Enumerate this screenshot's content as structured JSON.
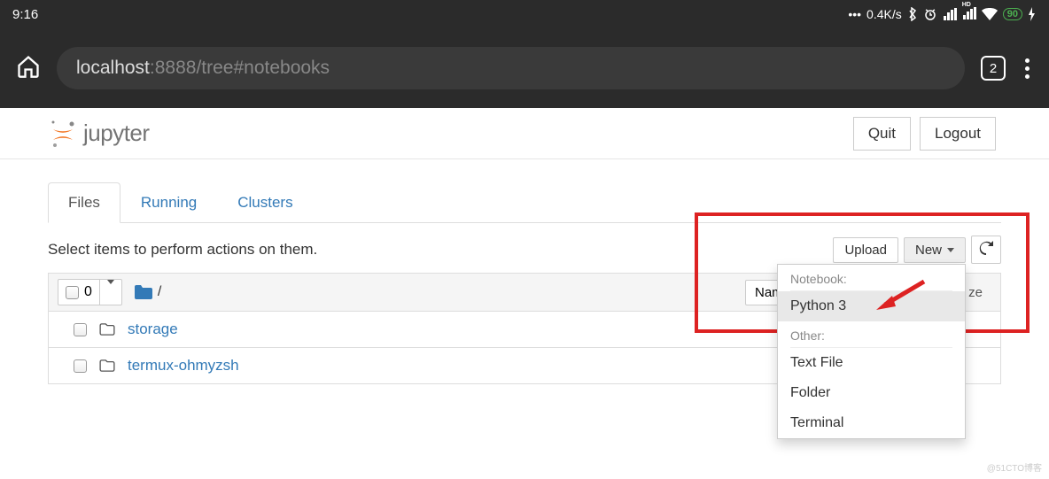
{
  "status": {
    "time": "9:16",
    "net_speed": "0.4K/s",
    "battery_pct": "90"
  },
  "browser": {
    "url_host": "localhost",
    "url_path": ":8888/tree#notebooks",
    "tab_count": "2"
  },
  "header": {
    "logo_text": "jupyter",
    "quit": "Quit",
    "logout": "Logout"
  },
  "tabs": {
    "files": "Files",
    "running": "Running",
    "clusters": "Clusters"
  },
  "actions": {
    "hint": "Select items to perform actions on them.",
    "upload": "Upload",
    "new": "New"
  },
  "listhdr": {
    "selected_count": "0",
    "crumb_root": "/",
    "name_col": "Name",
    "size_hint": "ze"
  },
  "files": [
    {
      "name": "storage"
    },
    {
      "name": "termux-ohmyzsh"
    }
  ],
  "menu": {
    "hdr_notebook": "Notebook:",
    "python3": "Python 3",
    "hdr_other": "Other:",
    "textfile": "Text File",
    "folder": "Folder",
    "terminal": "Terminal"
  },
  "watermark": "@51CTO博客"
}
